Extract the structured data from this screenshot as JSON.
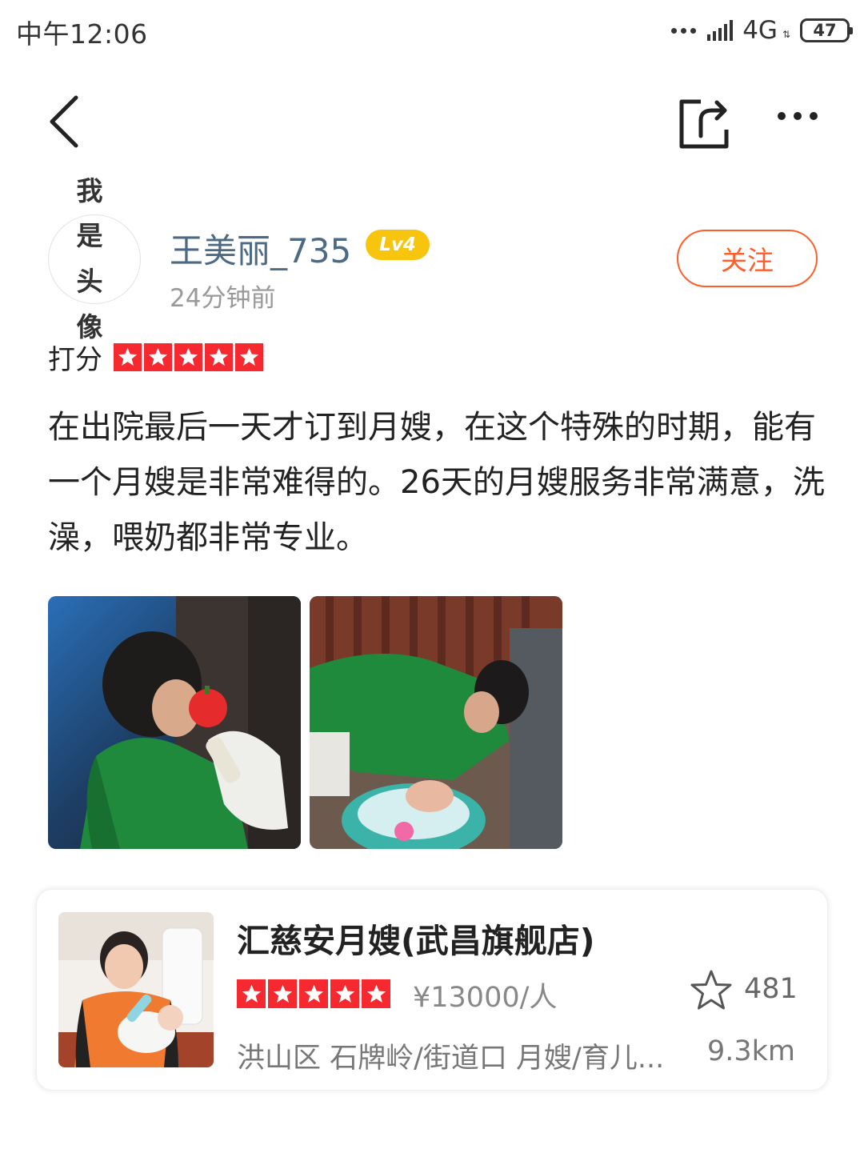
{
  "status_bar": {
    "time": "中午12:06",
    "network": "4G",
    "battery": "47"
  },
  "nav": {
    "back_icon": "chevron-left-icon",
    "share_icon": "share-icon",
    "more_icon": "more-icon"
  },
  "author": {
    "avatar_text": "我是头像",
    "name": "王美丽_735",
    "level": "Lv4",
    "time": "24分钟前",
    "follow_label": "关注"
  },
  "rating": {
    "label": "打分",
    "stars": 5,
    "star_color": "#f5292f"
  },
  "review": {
    "text": "在出院最后一天才订到月嫂，在这个特殊的时期，能有一个月嫂是非常难得的。26天的月嫂服务非常满意，洗澡，喂奶都非常专业。"
  },
  "photos": [
    {
      "subject": "nanny-feeding-baby-photo"
    },
    {
      "subject": "nanny-bathing-baby-photo"
    }
  ],
  "shop": {
    "name": "汇慈安月嫂(武昌旗舰店)",
    "stars": 5,
    "price": "¥13000/人",
    "favorite_icon": "star-outline-icon",
    "favorite_count": "481",
    "location": "洪山区 石牌岭/街道口 月嫂/育儿...",
    "distance": "9.3km"
  },
  "colors": {
    "accent": "#ff5e2a",
    "badge": "#f7c40e",
    "username": "#4d6a84",
    "star": "#f5292f"
  }
}
